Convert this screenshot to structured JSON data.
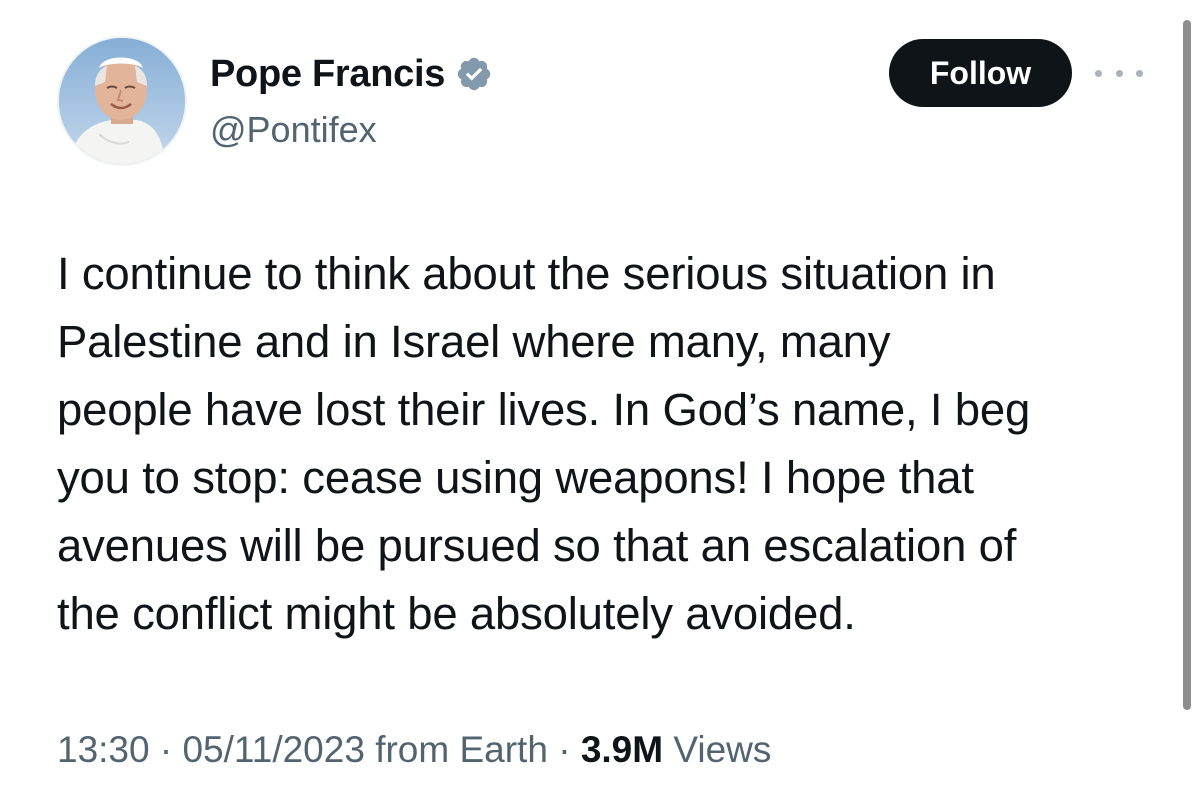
{
  "author": {
    "display_name": "Pope Francis",
    "handle": "@Pontifex",
    "verified": true,
    "avatar_icon": "profile-photo"
  },
  "actions": {
    "follow_label": "Follow",
    "more_icon": "more-dots-icon"
  },
  "tweet": {
    "lines": [
      "I continue to think about the serious situation in",
      "Palestine and in Israel where many, many",
      "people have lost their lives. In God’s name, I beg",
      "you to stop: cease using weapons! I hope that",
      "avenues will be pursued so that an escalation of",
      "the conflict might be absolutely avoided."
    ]
  },
  "meta": {
    "time": "13:30",
    "separator": "·",
    "date": "05/11/2023",
    "source": "from Earth",
    "views_count": "3.9M",
    "views_label": "Views"
  },
  "colors": {
    "text_primary": "#0f1419",
    "text_secondary": "#536471",
    "follow_bg": "#0f1419",
    "verified_badge": "#829aab"
  }
}
